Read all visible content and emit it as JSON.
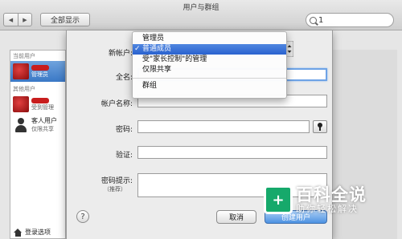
{
  "window": {
    "title": "用户与群组"
  },
  "toolbar": {
    "show_all_label": "全部显示",
    "back_icon": "◀",
    "forward_icon": "▶"
  },
  "search": {
    "value": "1",
    "icon": "search-icon"
  },
  "sidebar": {
    "current_header": "当前用户",
    "current_user": {
      "role": "管理员"
    },
    "other_header": "其他用户",
    "users": [
      {
        "role": "受到管理"
      },
      {
        "name": "客人用户",
        "role": "仅限共享"
      }
    ],
    "login_options_label": "登录选项"
  },
  "sheet": {
    "new_account_label": "新帐户:",
    "full_name_label": "全名:",
    "account_name_label": "帐户名称:",
    "password_label": "密码:",
    "verify_label": "验证:",
    "hint_label": "密码提示:",
    "hint_sub": "（推荐）",
    "help_label": "?",
    "cancel_label": "取消",
    "create_label": "创建用户"
  },
  "dropdown": {
    "items": [
      "管理员",
      "普通成员",
      "受\"家长控制\"的管理",
      "仅限共享",
      "群组"
    ],
    "selected": "普通成员",
    "check_mark": "✓"
  },
  "watermark": {
    "box_text": "+",
    "main": "百科全说",
    "sub": "助你轻松解决",
    "color": "#16a96b"
  }
}
